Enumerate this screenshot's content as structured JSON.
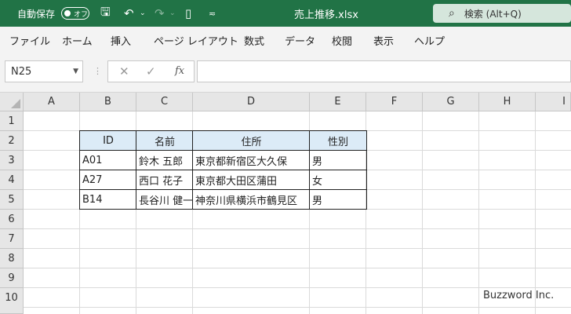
{
  "titlebar": {
    "autosave_label": "自動保存",
    "autosave_toggle": "オフ",
    "filename": "売上推移.xlsx",
    "search_text": "検索 (Alt+Q)",
    "icons": [
      "save-icon",
      "undo-icon",
      "redo-icon",
      "document-icon",
      "more-icon",
      "search-icon"
    ]
  },
  "ribbon": {
    "tabs": [
      "ファイル",
      "ホーム",
      "挿入",
      "ページ レイアウト",
      "数式",
      "データ",
      "校閲",
      "表示",
      "ヘルプ"
    ]
  },
  "formula_bar": {
    "name_box": "N25",
    "formula": ""
  },
  "sheet": {
    "columns": [
      "A",
      "B",
      "C",
      "D",
      "E",
      "F",
      "G",
      "H",
      "I"
    ],
    "rows": [
      "1",
      "2",
      "3",
      "4",
      "5",
      "6",
      "7",
      "8",
      "9",
      "10"
    ],
    "table": {
      "headers": [
        "ID",
        "名前",
        "住所",
        "性別"
      ],
      "rows": [
        [
          "A01",
          "鈴木 五郎",
          "東京都新宿区大久保",
          "男"
        ],
        [
          "A27",
          "西口 花子",
          "東京都大田区蒲田",
          "女"
        ],
        [
          "B14",
          "長谷川 健一",
          "神奈川県横浜市鶴見区",
          "男"
        ]
      ]
    }
  },
  "watermark": "Buzzword Inc.",
  "colors": {
    "excel_green": "#217346",
    "header_fill": "#dcebf7"
  }
}
